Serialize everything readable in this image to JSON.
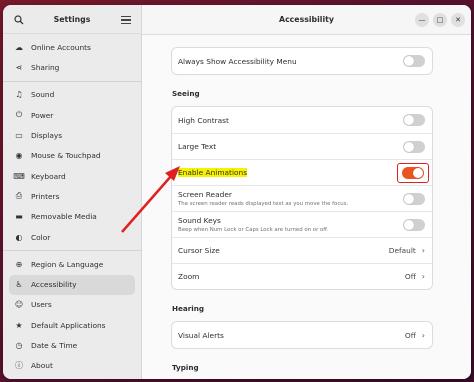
{
  "sidebar": {
    "title": "Settings",
    "items": [
      {
        "label": "Online Accounts",
        "icon": "cloud-icon",
        "glyph": "☁"
      },
      {
        "label": "Sharing",
        "icon": "share-icon",
        "glyph": "⋖"
      },
      {
        "label": "Sound",
        "icon": "music-note-icon",
        "glyph": "♫"
      },
      {
        "label": "Power",
        "icon": "power-icon",
        "glyph": "⏻"
      },
      {
        "label": "Displays",
        "icon": "display-icon",
        "glyph": "▭"
      },
      {
        "label": "Mouse & Touchpad",
        "icon": "mouse-icon",
        "glyph": "◉"
      },
      {
        "label": "Keyboard",
        "icon": "keyboard-icon",
        "glyph": "⌨"
      },
      {
        "label": "Printers",
        "icon": "printer-icon",
        "glyph": "⎙"
      },
      {
        "label": "Removable Media",
        "icon": "media-icon",
        "glyph": "▬"
      },
      {
        "label": "Color",
        "icon": "color-icon",
        "glyph": "◐"
      },
      {
        "label": "Region & Language",
        "icon": "globe-icon",
        "glyph": "⊕"
      },
      {
        "label": "Accessibility",
        "icon": "accessibility-icon",
        "glyph": "♿"
      },
      {
        "label": "Users",
        "icon": "users-icon",
        "glyph": "☺"
      },
      {
        "label": "Default Applications",
        "icon": "star-icon",
        "glyph": "★"
      },
      {
        "label": "Date & Time",
        "icon": "clock-icon",
        "glyph": "◷"
      },
      {
        "label": "About",
        "icon": "info-icon",
        "glyph": "ⓘ"
      }
    ],
    "active": "Accessibility"
  },
  "main": {
    "title": "Accessibility",
    "window_controls": {
      "minimize": "—",
      "maximize": "□",
      "close": "✕"
    },
    "top_row": {
      "label": "Always Show Accessibility Menu",
      "on": false
    },
    "seeing": {
      "title": "Seeing",
      "rows": {
        "high_contrast": {
          "label": "High Contrast",
          "on": false
        },
        "large_text": {
          "label": "Large Text",
          "on": false
        },
        "enable_animations": {
          "label": "Enable Animations",
          "on": true
        },
        "screen_reader": {
          "label": "Screen Reader",
          "sub": "The screen reader reads displayed text as you move the focus.",
          "on": false
        },
        "sound_keys": {
          "label": "Sound Keys",
          "sub": "Beep when Num Lock or Caps Lock are turned on or off.",
          "on": false
        },
        "cursor_size": {
          "label": "Cursor Size",
          "value": "Default"
        },
        "zoom": {
          "label": "Zoom",
          "value": "Off"
        }
      }
    },
    "hearing": {
      "title": "Hearing",
      "visual_alerts": {
        "label": "Visual Alerts",
        "value": "Off"
      }
    },
    "typing": {
      "title": "Typing"
    }
  },
  "colors": {
    "accent": "#e95420",
    "highlight": "#f7f200",
    "callout": "#e02020"
  }
}
